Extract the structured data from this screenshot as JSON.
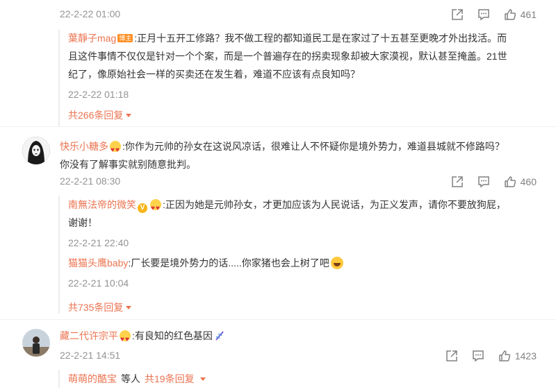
{
  "comments": [
    {
      "time": "22-2-22 01:00",
      "repost_icon": "share-icon",
      "comment_icon": "comment-icon",
      "like_icon": "like-icon",
      "likes": "461",
      "replies": [
        {
          "user": "葉靜子mag",
          "badge": "博主",
          "text_line1": ":正月十五开工修路？我不做工程的都知道民工是在家过了十五甚至更晚才外出找活。而",
          "text_line2": "且这件事情不仅仅是针对一个个案，而是一个普遍存在的拐卖现象却被大家漠视，默认甚至掩盖。21世",
          "text_line3": "纪了，像原始社会一样的买卖还在发生着，难道不应该有点良知吗？",
          "time": "22-2-22 01:18"
        }
      ],
      "more_replies": "共266条回复"
    },
    {
      "user": "快乐小糖多",
      "text_line1": ":你作为元帅的孙女在这说风凉话，很难让人不怀疑你是境外势力，难道县城就不修路吗？",
      "text_line2": "你没有了解事实就别随意批判。",
      "time": "22-2-21 08:30",
      "likes": "460",
      "replies": [
        {
          "user": "南無法帝的微笑",
          "text_line1": ":正因为她是元帅孙女，才更加应该为人民说话，为正义发声，请你不要放狗屁，",
          "text_line2": "谢谢！",
          "time": "22-2-21 22:40"
        },
        {
          "user": "猫猫头鹰baby",
          "text_line1": ":厂长要是境外势力的话.....你家猪也会上树了吧",
          "time": "22-2-21 10:04"
        }
      ],
      "more_replies": "共735条回复"
    },
    {
      "user": "藏二代许宗平",
      "text_line1": ":有良知的红色基因",
      "time": "22-2-21 14:51",
      "likes": "1423",
      "reply_preview_user": "萌萌的酷宝",
      "reply_preview_suffix": "等人",
      "more_replies": "共19条回复"
    }
  ],
  "colors": {
    "accent": "#eb7350",
    "muted": "#939393",
    "text": "#333333"
  }
}
